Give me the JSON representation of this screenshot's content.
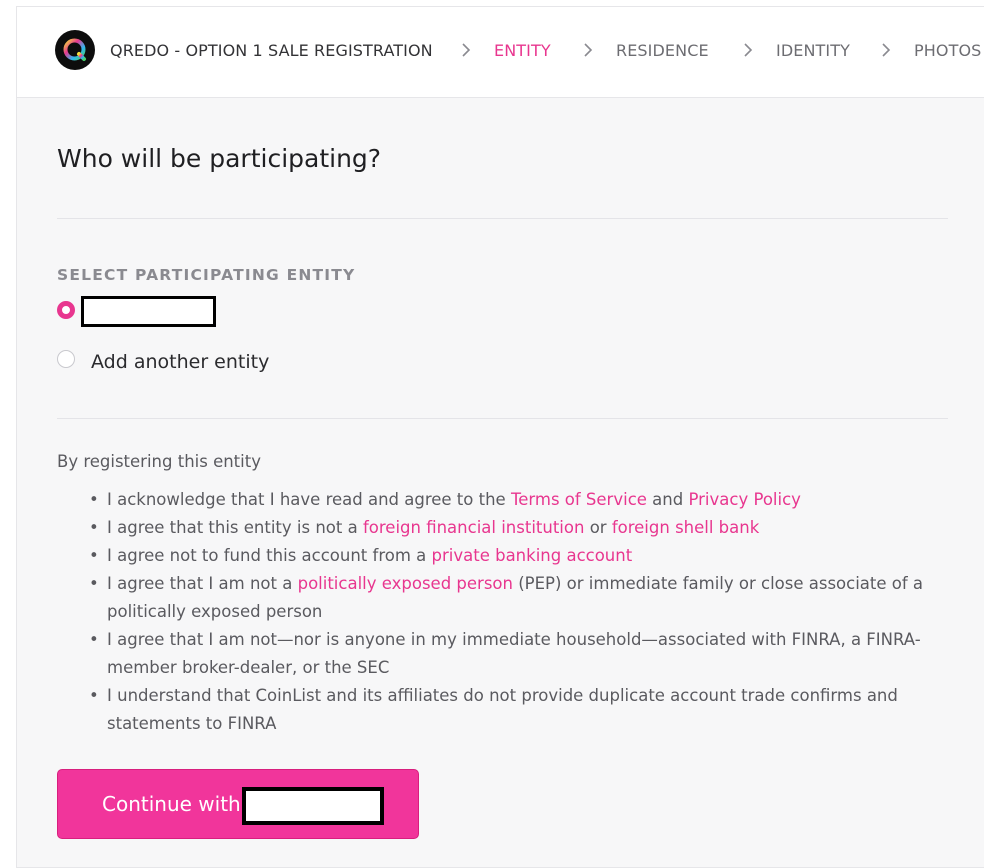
{
  "header": {
    "title": "QREDO - OPTION 1 SALE REGISTRATION",
    "steps": [
      "ENTITY",
      "RESIDENCE",
      "IDENTITY",
      "PHOTOS"
    ],
    "active_step": "ENTITY",
    "accent_color": "#e8368f"
  },
  "main": {
    "heading": "Who will be participating?",
    "section_label": "SELECT PARTICIPATING ENTITY",
    "options": [
      {
        "label": "",
        "selected": true,
        "redacted": true
      },
      {
        "label": "Add another entity",
        "selected": false
      }
    ],
    "intro": "By registering this entity",
    "terms": [
      {
        "parts": [
          {
            "text": "I acknowledge that I have read and agree to the "
          },
          {
            "text": "Terms of Service",
            "link": true
          },
          {
            "text": " and "
          },
          {
            "text": "Privacy Policy",
            "link": true
          }
        ]
      },
      {
        "parts": [
          {
            "text": "I agree that this entity is not a "
          },
          {
            "text": "foreign financial institution",
            "link": true
          },
          {
            "text": " or "
          },
          {
            "text": "foreign shell bank",
            "link": true
          }
        ]
      },
      {
        "parts": [
          {
            "text": "I agree not to fund this account from a "
          },
          {
            "text": "private banking account",
            "link": true
          }
        ]
      },
      {
        "parts": [
          {
            "text": "I agree that I am not a "
          },
          {
            "text": "politically exposed person",
            "link": true
          },
          {
            "text": " (PEP) or immediate family or close associate of a politically exposed person"
          }
        ]
      },
      {
        "parts": [
          {
            "text": "I agree that I am not—nor is anyone in my immediate household—associated with FINRA, a FINRA-member broker-dealer, or the SEC"
          }
        ]
      },
      {
        "parts": [
          {
            "text": "I understand that CoinList and its affiliates do not provide duplicate account trade confirms and statements to FINRA"
          }
        ]
      }
    ],
    "continue_button": {
      "label": "Continue with",
      "bg_color": "#f1359b"
    }
  }
}
